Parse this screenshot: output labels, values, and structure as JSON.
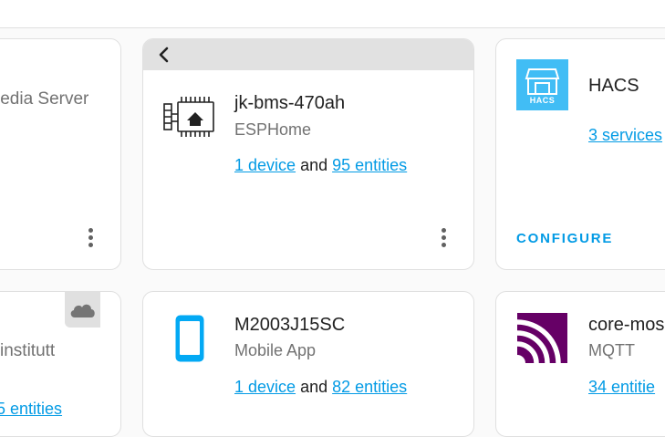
{
  "cards": {
    "media_server": {
      "subtitle": "ledia Server"
    },
    "jk_bms": {
      "title": "jk-bms-470ah",
      "subtitle": "ESPHome",
      "device_link": "1 device",
      "and": "and",
      "entities_link": "95 entities",
      "icon": "esphome-board-icon"
    },
    "hacs": {
      "title": "HACS",
      "logo_text": "HACS",
      "services_link": "3 services",
      "configure_label": "CONFIGURE"
    },
    "institutt": {
      "subtitle": "institutt",
      "entities_link": "5 entities",
      "icon": "cloud-icon"
    },
    "m2003": {
      "title": "M2003J15SC",
      "subtitle": "Mobile App",
      "device_link": "1 device",
      "and": "and",
      "entities_link": "82 entities",
      "icon": "phone-icon"
    },
    "core_mqtt": {
      "title": "core-mos",
      "subtitle": "MQTT",
      "entities_link": "34 entitie",
      "icon": "mqtt-icon"
    }
  },
  "colors": {
    "link": "#039be5",
    "hacs_blue": "#41bdf5",
    "phone_blue": "#03a9f4",
    "mqtt_purple": "#660066",
    "back_bar": "#e1e1e1"
  }
}
